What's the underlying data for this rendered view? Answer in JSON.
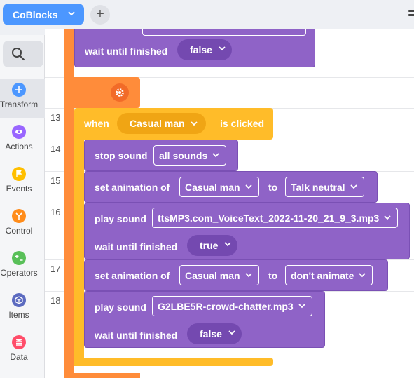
{
  "header": {
    "project_name": "CoBlocks",
    "add_label": "+"
  },
  "sidebar": {
    "search_icon": "search-icon",
    "categories": [
      {
        "label": "Transform",
        "color": "#4c97ff",
        "icon": "move-icon"
      },
      {
        "label": "Actions",
        "color": "#9966ff",
        "icon": "eye-icon"
      },
      {
        "label": "Events",
        "color": "#ffbf00",
        "icon": "flag-icon"
      },
      {
        "label": "Control",
        "color": "#ff8c1a",
        "icon": "branch-icon"
      },
      {
        "label": "Operators",
        "color": "#59c059",
        "icon": "plus-minus-icon"
      },
      {
        "label": "Items",
        "color": "#5c6bc0",
        "icon": "cube-icon"
      },
      {
        "label": "Data",
        "color": "#ff4d6a",
        "icon": "database-icon"
      }
    ]
  },
  "code": {
    "line_numbers": [
      "13",
      "14",
      "15",
      "16",
      "17",
      "18"
    ],
    "top_wait": {
      "label": "wait until finished",
      "value": "false"
    },
    "event_block": {
      "when": "when",
      "target": "Casual man",
      "suffix": "is clicked"
    },
    "stop_sound": {
      "label": "stop sound",
      "value": "all sounds"
    },
    "set_anim_1": {
      "label": "set animation of",
      "target": "Casual man",
      "to": "to",
      "value": "Talk neutral"
    },
    "play_sound_1": {
      "label": "play sound",
      "value": "ttsMP3.com_VoiceText_2022-11-20_21_9_3.mp3",
      "wait_label": "wait until finished",
      "wait_value": "true"
    },
    "set_anim_2": {
      "label": "set animation of",
      "target": "Casual man",
      "to": "to",
      "value": "don't animate"
    },
    "play_sound_2": {
      "label": "play sound",
      "value": "G2LBE5R-crowd-chatter.mp3",
      "wait_label": "wait until finished",
      "wait_value": "false"
    }
  },
  "colors": {
    "looks": "#8f63c7",
    "events": "#ffbc29",
    "control": "#ff8c3a",
    "accent": "#4c97ff"
  }
}
